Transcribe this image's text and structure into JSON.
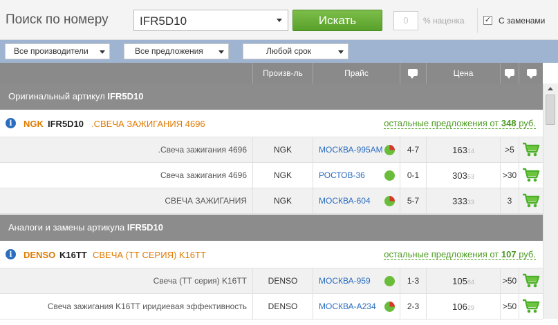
{
  "search": {
    "title": "Поиск по номеру",
    "value": "IFR5D10",
    "button": "Искать",
    "markup_value": "0",
    "markup_label": "% наценка",
    "replacements_label": "С заменами",
    "replacements_checked": "✓"
  },
  "filters": {
    "manufacturers": "Все производители",
    "offers": "Все предложения",
    "term": "Любой срок"
  },
  "columns": {
    "mfr": "Произв-ль",
    "price": "Прайс",
    "cost": "Цена"
  },
  "sections": [
    {
      "label": "Оригинальный артикул",
      "article": "IFR5D10",
      "group": {
        "brand": "NGK",
        "article": "IFR5D10",
        "desc": ".СВЕЧА ЗАЖИГАНИЯ 4696",
        "other_prefix": "остальные предложения от",
        "other_price": "348",
        "other_unit": "руб."
      },
      "rows": [
        {
          "desc": ".Свеча зажигания 4696",
          "mfr": "NGK",
          "price": "МОСКВА-995АМ",
          "dot": "part",
          "days": "4-7",
          "cost": "163",
          "cents": "14",
          "qty": ">5"
        },
        {
          "desc": "Свеча зажигания 4696",
          "mfr": "NGK",
          "price": "РОСТОВ-36",
          "dot": "full",
          "days": "0-1",
          "cost": "303",
          "cents": "53",
          "qty": ">30"
        },
        {
          "desc": "СВЕЧА ЗАЖИГАНИЯ",
          "mfr": "NGK",
          "price": "МОСКВА-604",
          "dot": "part",
          "days": "5-7",
          "cost": "333",
          "cents": "33",
          "qty": "3"
        }
      ]
    },
    {
      "label": "Аналоги и замены артикула",
      "article": "IFR5D10",
      "group": {
        "brand": "DENSO",
        "article": "K16TT",
        "desc": "СВЕЧА (ТТ СЕРИЯ) K16TT",
        "other_prefix": "остальные предложения от",
        "other_price": "107",
        "other_unit": "руб."
      },
      "rows": [
        {
          "desc": "Свеча (ТТ серия) K16TT",
          "mfr": "DENSO",
          "price": "МОСКВА-959",
          "dot": "full",
          "days": "1-3",
          "cost": "105",
          "cents": "84",
          "qty": ">50"
        },
        {
          "desc": "Свеча зажигания K16TT иридиевая эффективность",
          "mfr": "DENSO",
          "price": "МОСКВА-А234",
          "dot": "part",
          "days": "2-3",
          "cost": "106",
          "cents": "29",
          "qty": ">50"
        }
      ]
    }
  ],
  "colors": {
    "accent_green": "#58a12a",
    "brand_orange": "#e07a00",
    "link_blue": "#2a6dbf",
    "header_gray": "#8a8a8a",
    "filter_blue": "#9fb4d0"
  }
}
